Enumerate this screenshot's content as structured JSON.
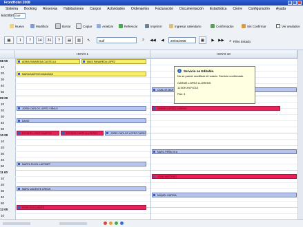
{
  "window": {
    "title": "FrontHotel 2008"
  },
  "menu": [
    "Sistema",
    "Booking",
    "Reservas",
    "Habitaciones",
    "Cargos",
    "Actividades",
    "Ordenantes",
    "Facturación",
    "Documentación",
    "Estadística",
    "Cierre",
    "Configuración",
    "Ayuda"
  ],
  "filtro": {
    "label": "Escritorio",
    "value": "Golf"
  },
  "toolbar": {
    "nuevo": "Nuevo",
    "modificar": "Modificar",
    "borrar": "Borrar",
    "copiar": "Copiar",
    "analizar": "Analizar",
    "refrescar": "Refrescar",
    "imprimir": "Imprimir",
    "ingresar_calendario": "Ingresar calendario",
    "confirmados": "Confirmados",
    "sin_confirmar": "Sin Confirmar",
    "ver_anulados": "Ver anulados"
  },
  "views": {
    "v1": "1",
    "v7": "7",
    "v14": "14",
    "v31": "31",
    "vq": "?"
  },
  "recurso": {
    "value": "Golf"
  },
  "fecha": {
    "value": "20/04/2008"
  },
  "filtro_estado": {
    "label": "Filtro Estado"
  },
  "columns": {
    "col1": "HOYO 1",
    "col2": "HOYO 10"
  },
  "times": [
    {
      "label": "08 00",
      "hour": true
    },
    {
      "label": "10",
      "hour": false
    },
    {
      "label": "20",
      "hour": false
    },
    {
      "label": "30",
      "hour": false
    },
    {
      "label": "40",
      "hour": false
    },
    {
      "label": "50",
      "hour": false
    },
    {
      "label": "09 00",
      "hour": true
    },
    {
      "label": "10",
      "hour": false
    },
    {
      "label": "20",
      "hour": false
    },
    {
      "label": "30",
      "hour": false
    },
    {
      "label": "40",
      "hour": false
    },
    {
      "label": "50",
      "hour": false
    },
    {
      "label": "10 00",
      "hour": true
    },
    {
      "label": "10",
      "hour": false
    },
    {
      "label": "20",
      "hour": false
    },
    {
      "label": "30",
      "hour": false
    },
    {
      "label": "40",
      "hour": false
    },
    {
      "label": "50",
      "hour": false
    },
    {
      "label": "11 00",
      "hour": true
    },
    {
      "label": "10",
      "hour": false
    },
    {
      "label": "20",
      "hour": false
    },
    {
      "label": "30",
      "hour": false
    },
    {
      "label": "40",
      "hour": false
    },
    {
      "label": "50",
      "hour": false
    },
    {
      "label": "12 00",
      "hour": true
    },
    {
      "label": "10",
      "hour": false
    }
  ],
  "appointments": {
    "a1": "ADRIA PANAREDA CASTELLA",
    "a2": "MAGI PANAREDA LOPEZ",
    "a3": "MARIA MARTOS MANZANO",
    "a4": "CARLOS MARTINEZ",
    "a5": "JORDI CARLOS LOPEZ VIÑALS",
    "a6": "CARME LOPEZ LLORENS",
    "a7": "DAVID",
    "a8": "ESTHER LOPEZ CAMPOS",
    "a9": "ESTHER CASTELLA PEREZ",
    "a10": "JORDI CARLOS LOPEZ CARDO",
    "a11": "MARC PEÑA VILA",
    "a12": "MARTA PUJOL LAFONET",
    "a13": "JOAN MARTINEZ",
    "a14": "MARC VALIENTE CREUS",
    "a15": "MIQUEL GARCIA",
    "a16": "PERE ROCA MARTI"
  },
  "tooltip": {
    "title": "Servicio no Editable.",
    "line1": "No se puede modificar el horario. Servicio confirmado.",
    "line2": "CARME LOPEZ LLORENS",
    "line3": "11:50H-HOYO10",
    "line4": "Pax: 4"
  },
  "colors": {
    "accent": "#2e5fd6",
    "confirmed": "#b7c4ef",
    "unconfirmed": "#f4f06a",
    "blocked": "#ea1f58"
  }
}
